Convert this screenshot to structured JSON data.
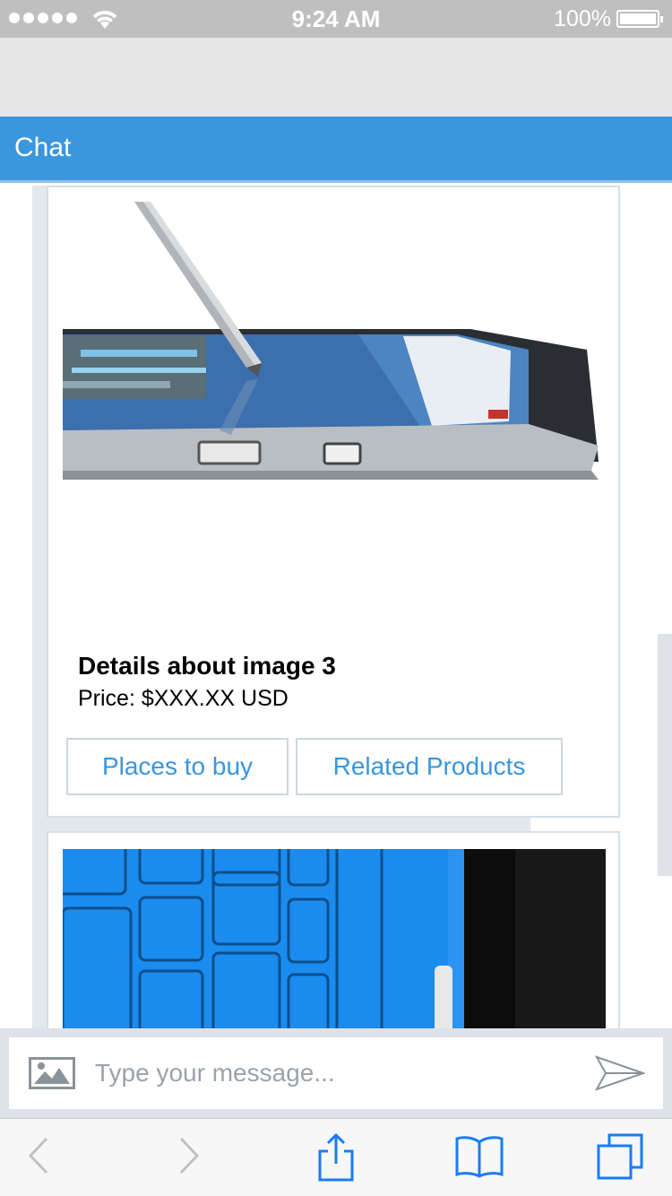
{
  "status_bar": {
    "time": "9:24 AM",
    "battery": "100%"
  },
  "header": {
    "title": "Chat"
  },
  "cards": [
    {
      "title": "Details about image 3",
      "price": "Price: $XXX.XX USD",
      "buttons": [
        "Places to buy",
        "Related Products"
      ]
    }
  ],
  "composer": {
    "placeholder": "Type your message..."
  },
  "icons": {
    "status": [
      "signal-icon",
      "wifi-icon",
      "battery-icon"
    ],
    "composer": [
      "image-upload-icon",
      "send-icon"
    ],
    "toolbar": [
      "back-icon",
      "forward-icon",
      "share-icon",
      "bookmarks-icon",
      "tabs-icon"
    ]
  },
  "colors": {
    "accent": "#3a96dd",
    "header_bg": "#3a96dd",
    "border": "#d5dee6"
  }
}
